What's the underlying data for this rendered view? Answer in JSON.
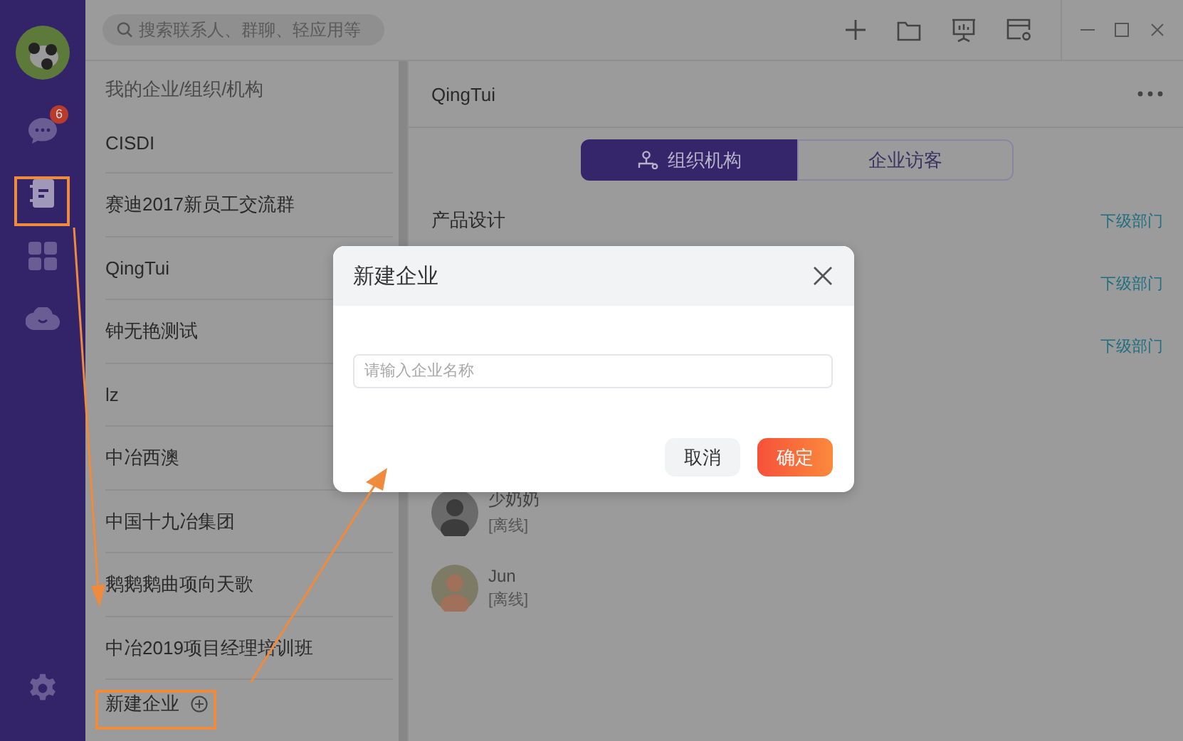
{
  "nav": [
    {
      "kind": "chat",
      "badge": "6",
      "selected": false
    },
    {
      "kind": "contacts",
      "selected": true
    },
    {
      "kind": "apps",
      "selected": false
    },
    {
      "kind": "cloud",
      "selected": false
    }
  ],
  "search": {
    "placeholder": "搜索联系人、群聊、轻应用等"
  },
  "org_list": {
    "title": "我的企业/组织/机构",
    "items": [
      "CISDI",
      "赛迪2017新员工交流群",
      "QingTui",
      "钟无艳测试",
      "lz",
      "中冶西澳",
      "中国十九冶集团",
      "鹅鹅鹅曲项向天歌",
      "中冶2019项目经理培训班"
    ],
    "add_label": "新建企业"
  },
  "panel": {
    "title": "QingTui",
    "tabs": [
      {
        "label": "组织机构",
        "selected": true
      },
      {
        "label": "企业访客",
        "selected": false
      }
    ],
    "departments": [
      {
        "name": "产品设计",
        "link": "下级部门"
      },
      {
        "link": "下级部门"
      },
      {
        "link": "下级部门"
      }
    ],
    "members": [
      {
        "name": "少奶奶",
        "status": "[离线]"
      },
      {
        "name": "Jun",
        "status": "[离线]"
      }
    ]
  },
  "dialog": {
    "title": "新建企业",
    "input": {
      "placeholder": "请输入企业名称"
    },
    "buttons": [
      {
        "label": "取消",
        "kind": "secondary"
      },
      {
        "label": "确定",
        "kind": "primary"
      }
    ]
  }
}
